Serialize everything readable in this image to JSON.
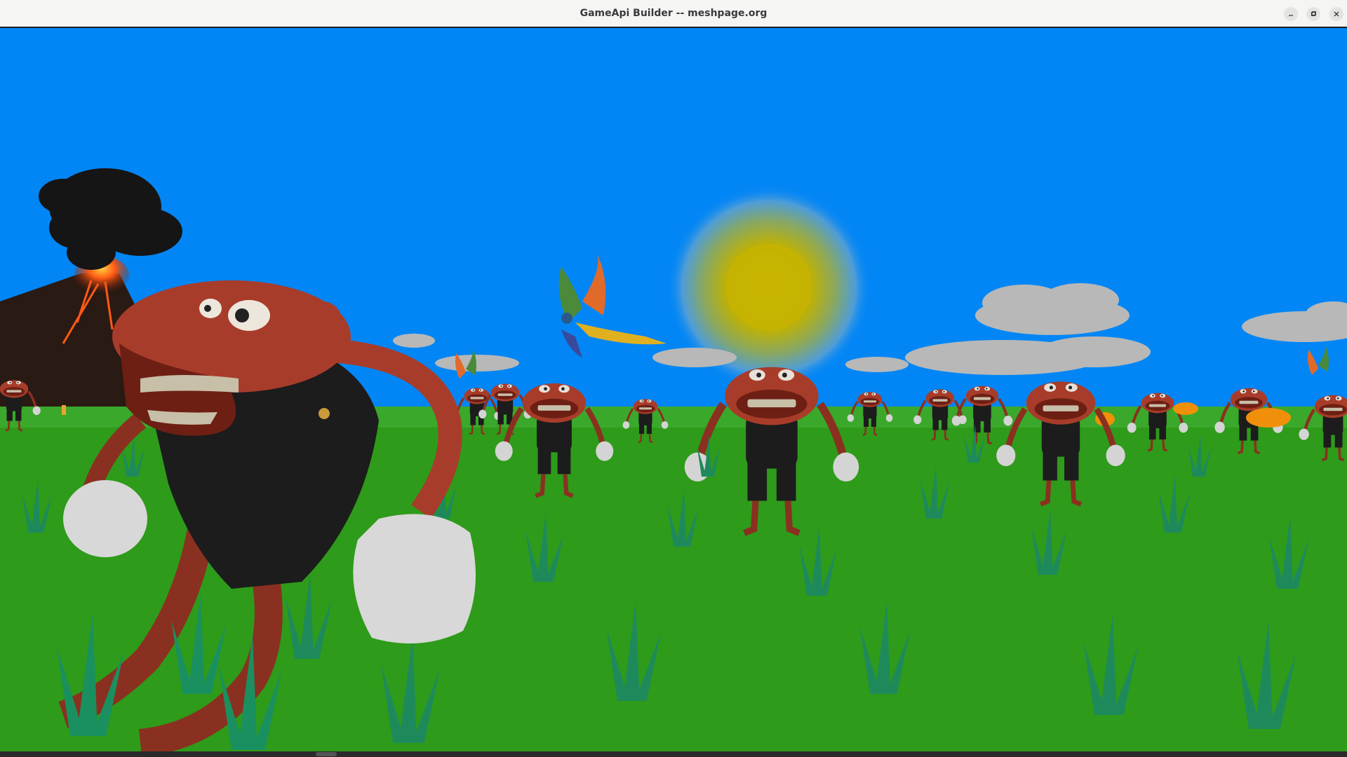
{
  "window": {
    "title": "GameApi Builder -- meshpage.org",
    "controls": [
      {
        "name": "minimize",
        "icon": "minimize-icon"
      },
      {
        "name": "maximize",
        "icon": "maximize-icon"
      },
      {
        "name": "close",
        "icon": "close-icon"
      }
    ]
  },
  "scene": {
    "description_icons": [
      "volcano-icon",
      "sun-icon",
      "phoenix-icon",
      "cloud-icon",
      "monkey-character-icon",
      "grass-icon",
      "pumpkin-icon"
    ],
    "colors": {
      "sky": "#0386f5",
      "grass": "#2e9b1a",
      "grass_blade": "#1e8a5c",
      "sun_inner": "#c8b400",
      "sun_outer": "#4f9dd8",
      "character_skin": "#a83c2a",
      "overalls": "#1c1c1c",
      "gloves": "#d8d8d8",
      "volcano": "#2a1a14",
      "lava": "#ff5a14",
      "smoke": "#151515",
      "cloud": "#b8b8b8"
    }
  }
}
